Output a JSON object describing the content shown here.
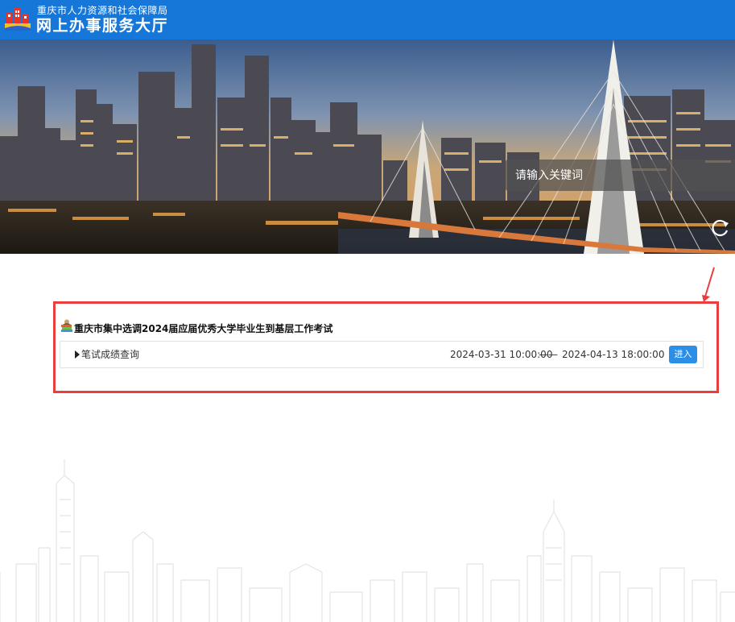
{
  "header": {
    "org_name": "重庆市人力资源和社会保障局",
    "hall_name": "网上办事服务大厅",
    "bar_color": "#1677d9"
  },
  "search": {
    "placeholder": "请输入关键词"
  },
  "exam": {
    "title": "重庆市集中选调2024届应届优秀大学毕业生到基层工作考试",
    "rows": [
      {
        "label": "笔试成绩查询",
        "start": "2024-03-31 10:00:00",
        "separator": "——",
        "end": "2024-04-13 18:00:00",
        "button": "进入"
      }
    ]
  },
  "icons": [
    "logo-icon",
    "refresh-icon",
    "exam-book-icon",
    "triangle-right-icon",
    "arrow-annotation-icon"
  ],
  "colors": {
    "accent": "#1677d9",
    "button": "#2b8fe8",
    "annotation": "#e83e3e"
  }
}
